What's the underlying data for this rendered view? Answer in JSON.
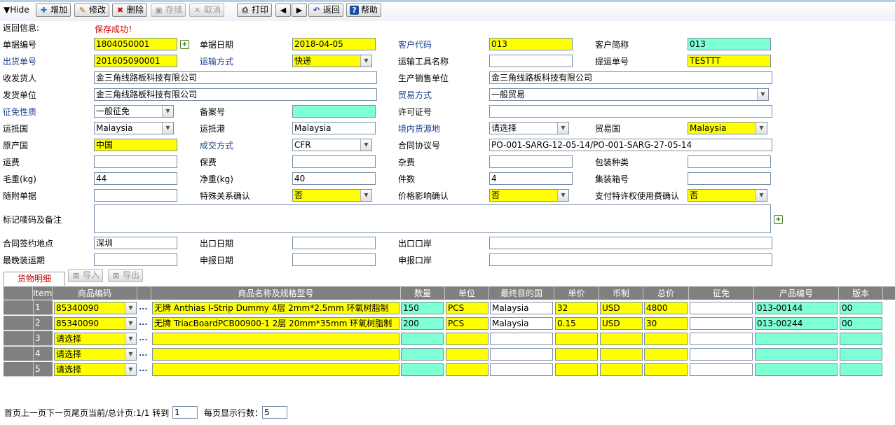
{
  "toolbar": {
    "hide_label": "▼Hide",
    "buttons": [
      {
        "label": "增加",
        "icon": "plus-icon"
      },
      {
        "label": "修改",
        "icon": "edit-icon"
      },
      {
        "label": "删除",
        "icon": "delete-icon"
      },
      {
        "label": "存储",
        "icon": "save-icon"
      },
      {
        "label": "取消",
        "icon": "cancel-icon"
      },
      {
        "label": "打印",
        "icon": "print-icon"
      },
      {
        "label": "",
        "icon": "arrow-left-icon"
      },
      {
        "label": "",
        "icon": "arrow-right-icon"
      },
      {
        "label": "返回",
        "icon": "back-icon"
      },
      {
        "label": "帮助",
        "icon": "help-icon"
      }
    ]
  },
  "form": {
    "return_info_label": "返回信息:",
    "return_info_value": "保存成功！",
    "doc_no_label": "单据编号",
    "doc_no": "1804050001",
    "doc_date_label": "单据日期",
    "doc_date": "2018-04-05",
    "customer_code_label": "客户代码",
    "customer_code": "013",
    "customer_short_label": "客户简称",
    "customer_short": "013",
    "shipment_no_label": "出货单号",
    "shipment_no": "201605090001",
    "transport_label": "运输方式",
    "transport": "快递",
    "vehicle_label": "运输工具名称",
    "vehicle": "",
    "bl_label": "提运单号",
    "bl": "TESTTT",
    "consignee_label": "收发货人",
    "consignee": "金三角线路板科技有限公司",
    "producer_label": "生产销售单位",
    "producer": "金三角线路板科技有限公司",
    "shipper_label": "发货单位",
    "shipper": "金三角线路板科技有限公司",
    "trade_mode_label": "贸易方式",
    "trade_mode": "一般贸易",
    "levy_label": "征免性质",
    "levy": "一般征免",
    "record_label": "备案号",
    "record": "",
    "license_label": "许可证号",
    "license": "",
    "dest_country_label": "运抵国",
    "dest_country": "Malaysia",
    "dest_port_label": "运抵港",
    "dest_port": "Malaysia",
    "origin_place_label": "境内货源地",
    "origin_place": "请选择",
    "trade_country_label": "贸易国",
    "trade_country": "Malaysia",
    "origin_country_label": "原产国",
    "origin_country": "中国",
    "deal_label": "成交方式",
    "deal": "CFR",
    "contract_label": "合同协议号",
    "contract": "PO-001-SARG-12-05-14/PO-001-SARG-27-05-14",
    "freight_label": "运费",
    "freight": "",
    "insurance_label": "保费",
    "insurance": "",
    "misc_label": "杂费",
    "misc": "",
    "packing_label": "包装种类",
    "packing": "",
    "gross_label": "毛重(kg)",
    "gross": "44",
    "net_label": "净重(kg)",
    "net": "40",
    "pieces_label": "件数",
    "pieces": "4",
    "container_label": "集装箱号",
    "container": "",
    "docs_label": "随附单据",
    "docs": "",
    "special_label": "特殊关系确认",
    "special": "否",
    "price_label": "价格影响确认",
    "price": "否",
    "royalty_label": "支付特许权使用费确认",
    "royalty": "否",
    "remarks_label": "标记唛码及备注",
    "remarks": "",
    "sign_place_label": "合同签约地点",
    "sign_place": "深圳",
    "export_date_label": "出口日期",
    "export_date": "",
    "export_port_label": "出口口岸",
    "export_port": "",
    "latest_ship_label": "最晚装运期",
    "latest_ship": "",
    "declare_date_label": "申报日期",
    "declare_date": "",
    "declare_port_label": "申报口岸",
    "declare_port": ""
  },
  "goods": {
    "tab_label": "货物明细",
    "import_label": "导入",
    "export_label": "导出",
    "columns": [
      "Item",
      "商品编码",
      "商品名称及规格型号",
      "数量",
      "单位",
      "最终目的国",
      "单价",
      "币制",
      "总价",
      "征免",
      "产品编号",
      "版本"
    ],
    "rows": [
      {
        "item": "1",
        "code": "85340090",
        "name": "无牌 Anthias I-Strip Dummy 4层 2mm*2.5mm 环氧树脂制",
        "qty": "150",
        "unit": "PCS",
        "dest": "Malaysia",
        "price": "32",
        "currency": "USD",
        "total": "4800",
        "levy": "",
        "product_no": "013-00144",
        "version": "00"
      },
      {
        "item": "2",
        "code": "85340090",
        "name": "无牌 TriacBoardPCB00900-1 2层 20mm*35mm 环氧树脂制",
        "qty": "200",
        "unit": "PCS",
        "dest": "Malaysia",
        "price": "0.15",
        "currency": "USD",
        "total": "30",
        "levy": "",
        "product_no": "013-00244",
        "version": "00"
      },
      {
        "item": "3",
        "code": "请选择",
        "name": "",
        "qty": "",
        "unit": "",
        "dest": "",
        "price": "",
        "currency": "",
        "total": "",
        "levy": "",
        "product_no": "",
        "version": ""
      },
      {
        "item": "4",
        "code": "请选择",
        "name": "",
        "qty": "",
        "unit": "",
        "dest": "",
        "price": "",
        "currency": "",
        "total": "",
        "levy": "",
        "product_no": "",
        "version": ""
      },
      {
        "item": "5",
        "code": "请选择",
        "name": "",
        "qty": "",
        "unit": "",
        "dest": "",
        "price": "",
        "currency": "",
        "total": "",
        "levy": "",
        "product_no": "",
        "version": ""
      }
    ]
  },
  "pager": {
    "text": "首页上一页下一页尾页当前/总计页:1/1 转到",
    "goto_value": "1",
    "per_page_label": "每页显示行数：",
    "per_page_value": "5"
  }
}
